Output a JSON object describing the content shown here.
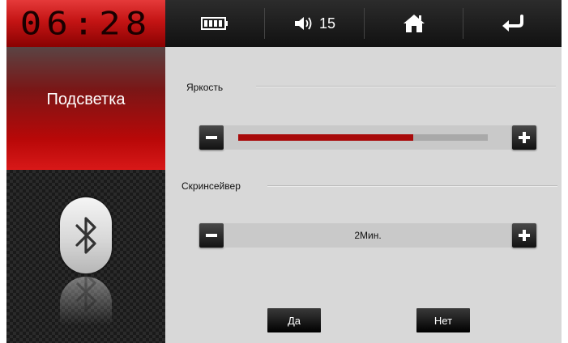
{
  "clock": {
    "time": "06:28"
  },
  "sidebar": {
    "active_item": {
      "label": "Подсветка"
    },
    "bluetooth": {
      "icon": "bluetooth-icon"
    }
  },
  "topbar": {
    "battery": {
      "icon": "battery-icon"
    },
    "volume": {
      "icon": "speaker-icon",
      "level": "15"
    },
    "home": {
      "icon": "home-icon"
    },
    "back": {
      "icon": "back-arrow-icon"
    }
  },
  "brightness": {
    "label": "Яркость",
    "level_fraction": 0.7,
    "decrease_icon": "minus-icon",
    "increase_icon": "plus-icon"
  },
  "screensaver": {
    "label": "Скринсейвер",
    "value": "2Мин.",
    "decrease_icon": "minus-icon",
    "increase_icon": "plus-icon"
  },
  "dialog": {
    "yes_label": "Да",
    "no_label": "Нет"
  },
  "colors": {
    "accent_red": "#a80a0a",
    "panel_bg": "#d8d8d8",
    "topbar_bg": "#1c1c1c"
  }
}
